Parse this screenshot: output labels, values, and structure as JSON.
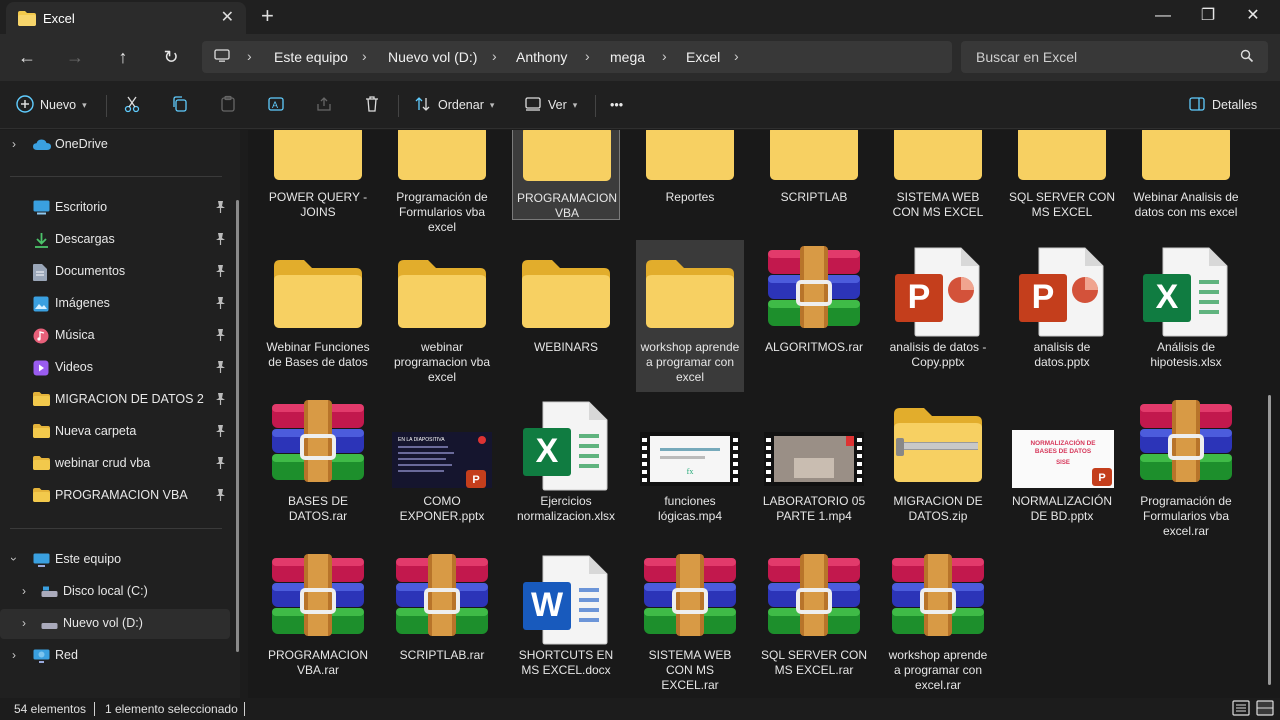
{
  "window": {
    "tab_title": "Excel",
    "tab_close": "✕",
    "new_tab": "+",
    "minimize": "—",
    "maximize": "❐",
    "close": "✕"
  },
  "nav": {
    "back": "←",
    "forward": "→",
    "up": "↑",
    "refresh": "↻"
  },
  "breadcrumb": [
    "Este equipo",
    "Nuevo vol (D:)",
    "Anthony",
    "mega",
    "Excel"
  ],
  "search": {
    "placeholder": "Buscar en Excel"
  },
  "commands": {
    "new_label": "Nuevo",
    "sort_label": "Ordenar",
    "view_label": "Ver",
    "more_label": "•••",
    "details_label": "Detalles"
  },
  "sidebar": {
    "onedrive": "OneDrive",
    "quick": [
      {
        "label": "Escritorio",
        "icon": "desktop-icon",
        "color": "#3aa0e0"
      },
      {
        "label": "Descargas",
        "icon": "download-icon",
        "color": "#4cc36a"
      },
      {
        "label": "Documentos",
        "icon": "document-icon",
        "color": "#9aa6b8"
      },
      {
        "label": "Imágenes",
        "icon": "image-icon",
        "color": "#3aa0e0"
      },
      {
        "label": "Música",
        "icon": "music-icon",
        "color": "#e8607a"
      },
      {
        "label": "Videos",
        "icon": "video-icon",
        "color": "#9a5cf0"
      },
      {
        "label": "MIGRACION DE DATOS 2",
        "icon": "folder-icon",
        "color": "#f2c94c"
      },
      {
        "label": "Nueva carpeta",
        "icon": "folder-icon",
        "color": "#f2c94c"
      },
      {
        "label": "webinar crud vba",
        "icon": "folder-icon",
        "color": "#f2c94c"
      },
      {
        "label": "PROGRAMACION VBA",
        "icon": "folder-icon",
        "color": "#f2c94c"
      }
    ],
    "this_pc": "Este equipo",
    "drives": [
      "Disco local (C:)",
      "Nuevo vol (D:)"
    ],
    "network": "Red"
  },
  "files": [
    {
      "name": "POWER QUERY - JOINS",
      "type": "folder"
    },
    {
      "name": "Programación de Formularios vba excel",
      "type": "folder"
    },
    {
      "name": "PROGRAMACION VBA",
      "type": "folder"
    },
    {
      "name": "Reportes",
      "type": "folder"
    },
    {
      "name": "SCRIPTLAB",
      "type": "folder"
    },
    {
      "name": "SISTEMA WEB CON MS EXCEL",
      "type": "folder"
    },
    {
      "name": "SQL SERVER CON MS EXCEL",
      "type": "folder"
    },
    {
      "name": "Webinar Analisis de datos con ms excel",
      "type": "folder"
    },
    {
      "name": "Webinar Funciones de Bases de datos",
      "type": "folder"
    },
    {
      "name": "webinar programacion vba excel",
      "type": "folder"
    },
    {
      "name": "WEBINARS",
      "type": "folder"
    },
    {
      "name": "workshop aprende a programar con excel",
      "type": "folder"
    },
    {
      "name": "ALGORITMOS.rar",
      "type": "rar"
    },
    {
      "name": "analisis de datos - Copy.pptx",
      "type": "pptx"
    },
    {
      "name": "analisis de datos.pptx",
      "type": "pptx"
    },
    {
      "name": "Análisis de hipotesis.xlsx",
      "type": "xlsx"
    },
    {
      "name": "BASES DE DATOS.rar",
      "type": "rar"
    },
    {
      "name": "COMO EXPONER.pptx",
      "type": "pptx-thumb-dark"
    },
    {
      "name": "Ejercicios normalizacion.xlsx",
      "type": "xlsx"
    },
    {
      "name": "funciones lógicas.mp4",
      "type": "video-white"
    },
    {
      "name": "LABORATORIO 05 PARTE 1.mp4",
      "type": "video-room"
    },
    {
      "name": "MIGRACION DE DATOS.zip",
      "type": "zip"
    },
    {
      "name": "NORMALIZACIÓN DE BD.pptx",
      "type": "pptx-thumb-white"
    },
    {
      "name": "Programación de Formularios vba excel.rar",
      "type": "rar"
    },
    {
      "name": "PROGRAMACION VBA.rar",
      "type": "rar"
    },
    {
      "name": "SCRIPTLAB.rar",
      "type": "rar"
    },
    {
      "name": "SHORTCUTS  EN MS EXCEL.docx",
      "type": "docx"
    },
    {
      "name": "SISTEMA WEB CON MS EXCEL.rar",
      "type": "rar"
    },
    {
      "name": "SQL SERVER CON MS EXCEL.rar",
      "type": "rar"
    },
    {
      "name": "workshop aprende a programar con excel.rar",
      "type": "rar"
    }
  ],
  "thumbs": {
    "como_exponer": "EN LA DIAPOSITIVA",
    "normalizacion_title": "NORMALIZACIÓN DE BASES DE DATOS",
    "normalizacion_tag": "SISE",
    "excel_letter": "X",
    "word_letter": "W",
    "ppt_letter": "P"
  },
  "status": {
    "count": "54 elementos",
    "selected": "1 elemento seleccionado"
  }
}
